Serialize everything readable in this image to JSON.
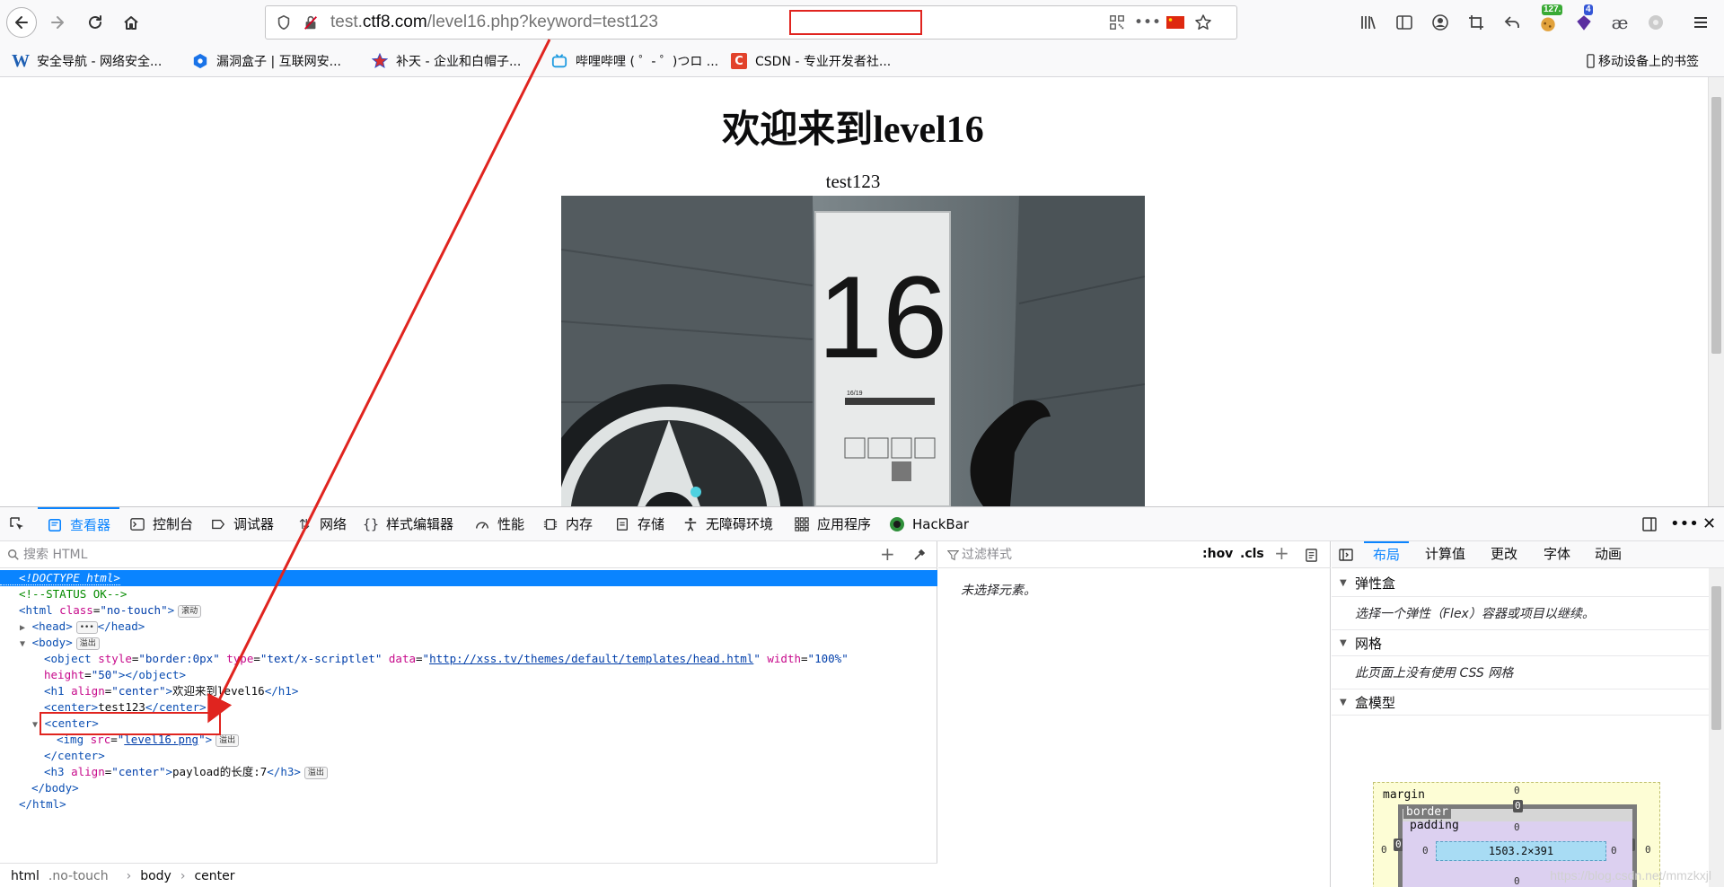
{
  "browser": {
    "url": {
      "prefix": "test.",
      "host": "ctf8.com",
      "path": "/level16.php?",
      "query": "keyword=test123"
    },
    "toolbar_badges": {
      "sync": "127.",
      "ext": "4"
    }
  },
  "bookmarks": [
    {
      "label": "安全导航 - 网络安全..."
    },
    {
      "label": "漏洞盒子 | 互联网安..."
    },
    {
      "label": "补天 - 企业和白帽子..."
    },
    {
      "label": "哔哩哔哩 ( ゜- ゜)つロ ..."
    },
    {
      "label": "CSDN - 专业开发者社..."
    }
  ],
  "mobile_bookmarks": "移动设备上的书签",
  "page": {
    "heading": "欢迎来到level16",
    "center_text": "test123",
    "sign_number": "16",
    "sign_small": "16/19"
  },
  "devtools": {
    "tabs": [
      "查看器",
      "控制台",
      "调试器",
      "网络",
      "样式编辑器",
      "性能",
      "内存",
      "存储",
      "无障碍环境",
      "应用程序",
      "HackBar"
    ],
    "search_placeholder": "搜索 HTML",
    "markup": {
      "doctype": "<!DOCTYPE html>",
      "comment": "<!--STATUS OK-->",
      "html_class": "no-touch",
      "scroll_badge": "滚动",
      "event_badge": "溢出",
      "object_style": "border:0px",
      "object_type": "text/x-scriptlet",
      "object_data": "http://xss.tv/themes/default/templates/head.html",
      "object_width": "100%",
      "object_height": "50",
      "h1_align": "center",
      "h1_text": "欢迎来到level16",
      "center_text": "test123",
      "img_src": "level16.png",
      "h3_align": "center",
      "h3_text": "payload的长度:7"
    },
    "breadcrumbs": {
      "html": "html",
      "html_class": ".no-touch",
      "body": "body",
      "center": "center"
    },
    "rules": {
      "filter_placeholder": "过滤样式",
      "hov": ":hov",
      "cls": ".cls",
      "empty": "未选择元素。"
    },
    "layout": {
      "tabs": [
        "布局",
        "计算值",
        "更改",
        "字体",
        "动画"
      ],
      "flex_title": "弹性盒",
      "flex_body": "选择一个弹性（Flex）容器或项目以继续。",
      "grid_title": "网格",
      "grid_body": "此页面上没有使用 CSS 网格",
      "boxmodel_title": "盒模型",
      "boxmodel": {
        "margin_label": "margin",
        "border_label": "border",
        "padding_label": "padding",
        "content_size": "1503.2×391",
        "zero": "0"
      }
    }
  },
  "watermark": "https://blog.csdn.net/mmzkxjl"
}
